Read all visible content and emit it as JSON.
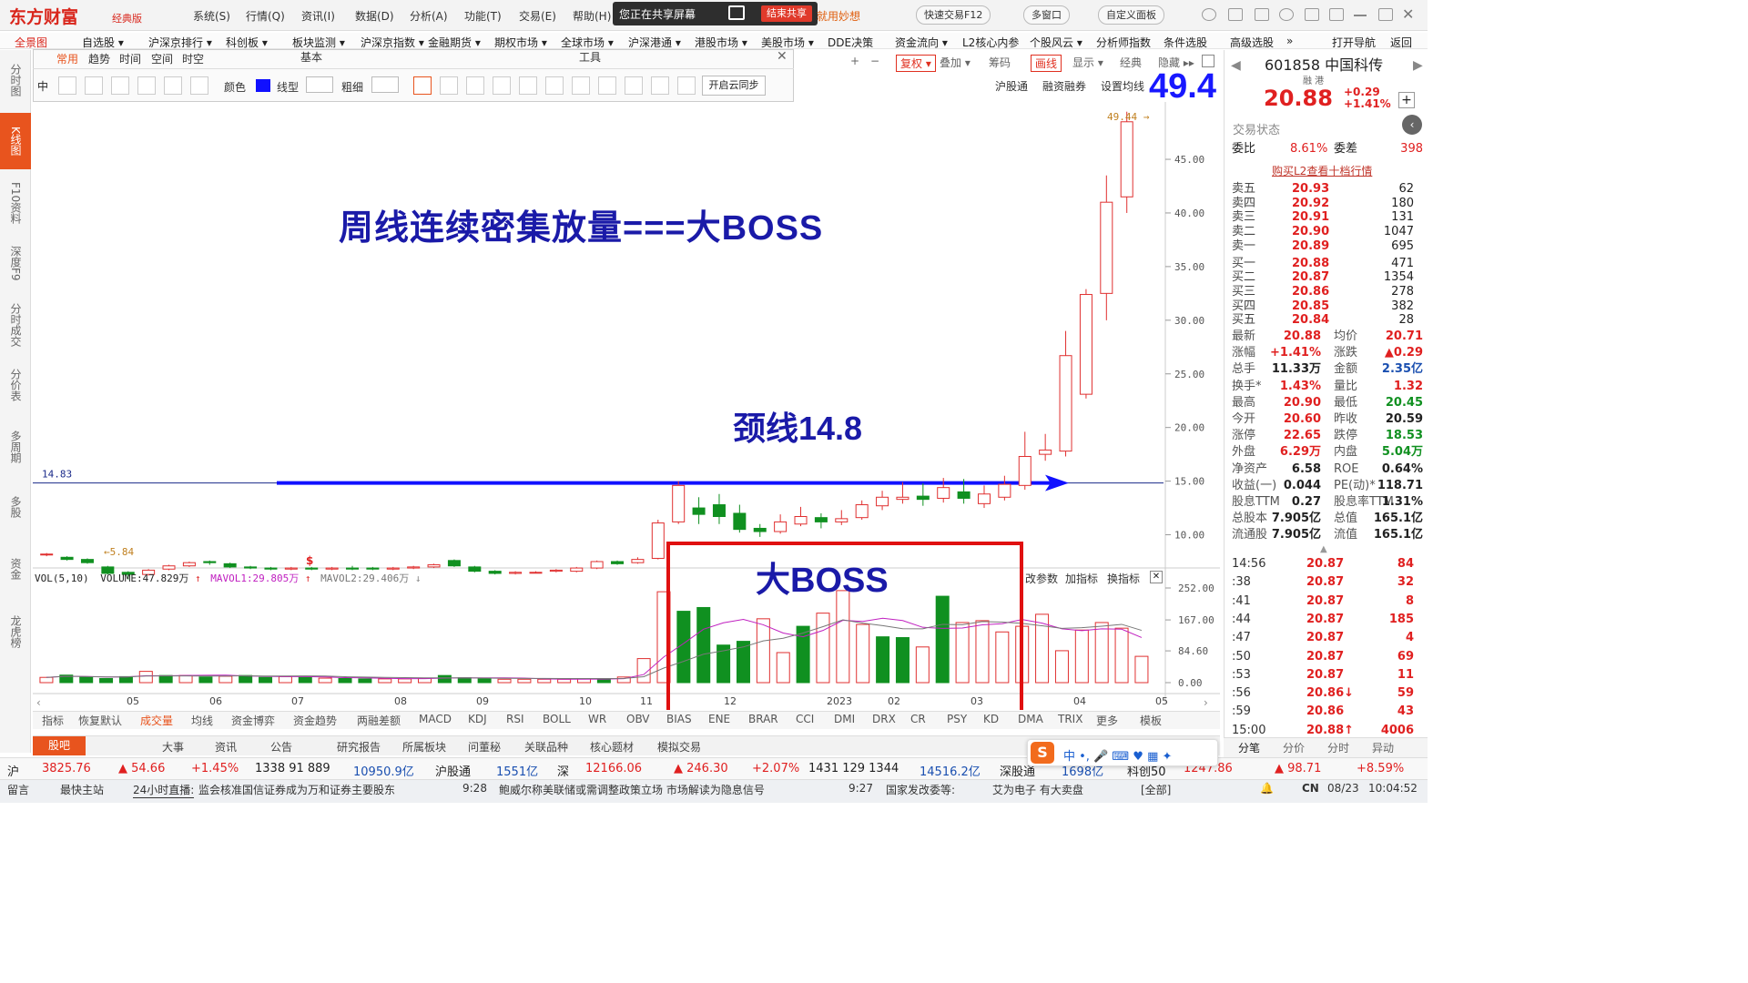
{
  "app": {
    "logo": "东方财富",
    "edition": "经典版"
  },
  "top_menu": [
    "系统(S)",
    "行情(Q)",
    "资讯(I)",
    "数据(D)",
    "分析(A)",
    "功能(T)",
    "交易(E)",
    "帮助(H)"
  ],
  "share": {
    "status": "您正在共享屏幕",
    "end_button": "结束共享",
    "slogan": "就用妙想"
  },
  "top_buttons": [
    "快速交易F12",
    "多窗口",
    "自定义面板"
  ],
  "nav": [
    "全景图",
    "自选股 ▾",
    "沪深京排行 ▾",
    "科创板 ▾",
    "板块监测 ▾",
    "沪深京指数 ▾",
    "金融期货 ▾",
    "期权市场 ▾",
    "全球市场 ▾",
    "沪深港通 ▾",
    "港股市场 ▾",
    "美股市场 ▾",
    "DDE决策",
    "资金流向 ▾",
    "L2核心内参",
    "个股风云 ▾",
    "分析师指数",
    "条件选股",
    "高级选股",
    "»",
    "打开导航",
    "返回"
  ],
  "left_tabs": [
    "分时图",
    "K线图",
    "F10资料",
    "深度F9",
    "分时成交",
    "分价表",
    "多周期",
    "多股",
    "资金",
    "龙虎榜"
  ],
  "toolpanel": {
    "tabs": [
      "常用",
      "趋势",
      "时间",
      "空间",
      "时空"
    ],
    "section_basic": "基本",
    "section_tools": "工具",
    "color_label": "颜色",
    "line_type_label": "线型",
    "thickness_label": "粗细",
    "cloud_sync": "开启云同步",
    "side_label": "中"
  },
  "kline_toolbar": [
    "+",
    "−",
    "复权 ▾",
    "叠加 ▾",
    "筹码",
    "画线",
    "显示 ▾",
    "经典",
    "隐藏 ▸▸"
  ],
  "kline_sub": [
    "沪股通",
    "融资融券",
    "设置均线"
  ],
  "annotations": {
    "title": "周线连续密集放量===大BOSS",
    "neckline": "颈线14.8",
    "boss_box": "大BOSS",
    "big_price": "49.4"
  },
  "chart_data": {
    "type": "candlestick",
    "period": "weekly",
    "price_axis": {
      "ticks": [
        10.0,
        15.0,
        20.0,
        25.0,
        30.0,
        35.0,
        40.0,
        45.0
      ],
      "min": 7.5,
      "max": 49.5
    },
    "neckline": 14.83,
    "high_label": "49.44",
    "low_label": "5.84",
    "x_labels": [
      "05",
      "06",
      "07",
      "08",
      "09",
      "10",
      "11",
      "12",
      "2023",
      "02",
      "03",
      "04",
      "05"
    ],
    "candles": [
      [
        8.2,
        8.2,
        8.0,
        8.3
      ],
      [
        7.9,
        7.7,
        7.6,
        8.0
      ],
      [
        7.7,
        7.4,
        7.3,
        7.8
      ],
      [
        7.0,
        6.4,
        6.3,
        7.1
      ],
      [
        6.5,
        6.3,
        5.84,
        6.6
      ],
      [
        6.3,
        6.7,
        6.2,
        6.8
      ],
      [
        6.8,
        7.1,
        6.7,
        7.2
      ],
      [
        7.1,
        7.4,
        7.0,
        7.5
      ],
      [
        7.5,
        7.4,
        7.2,
        7.6
      ],
      [
        7.3,
        7.0,
        6.9,
        7.4
      ],
      [
        7.0,
        6.9,
        6.8,
        7.1
      ],
      [
        6.9,
        6.8,
        6.7,
        7.0
      ],
      [
        6.8,
        6.9,
        6.7,
        7.0
      ],
      [
        6.9,
        6.8,
        6.7,
        7.0
      ],
      [
        6.8,
        6.9,
        6.7,
        7.0
      ],
      [
        6.9,
        6.8,
        6.7,
        7.1
      ],
      [
        6.9,
        6.8,
        6.7,
        7.0
      ],
      [
        6.8,
        6.9,
        6.7,
        7.0
      ],
      [
        6.9,
        7.0,
        6.8,
        7.1
      ],
      [
        7.0,
        7.2,
        6.9,
        7.3
      ],
      [
        7.6,
        7.1,
        7.0,
        7.7
      ],
      [
        7.0,
        6.6,
        6.5,
        7.1
      ],
      [
        6.6,
        6.4,
        6.3,
        6.7
      ],
      [
        6.4,
        6.5,
        6.3,
        6.6
      ],
      [
        6.5,
        6.5,
        6.4,
        6.6
      ],
      [
        6.6,
        6.7,
        6.5,
        6.8
      ],
      [
        6.6,
        6.9,
        6.5,
        7.0
      ],
      [
        6.9,
        7.5,
        6.8,
        7.6
      ],
      [
        7.5,
        7.3,
        7.2,
        7.6
      ],
      [
        7.4,
        7.7,
        7.3,
        7.9
      ],
      [
        7.8,
        11.1,
        7.7,
        11.4
      ],
      [
        11.2,
        14.6,
        11.0,
        15.0
      ],
      [
        12.5,
        11.9,
        11.0,
        13.5
      ],
      [
        12.8,
        11.7,
        11.0,
        13.8
      ],
      [
        12.0,
        10.5,
        10.2,
        12.8
      ],
      [
        10.6,
        10.3,
        9.8,
        11.0
      ],
      [
        10.3,
        11.2,
        10.1,
        11.9
      ],
      [
        11.0,
        11.7,
        10.8,
        12.6
      ],
      [
        11.6,
        11.2,
        10.6,
        12.0
      ],
      [
        11.2,
        11.5,
        10.9,
        12.3
      ],
      [
        11.6,
        12.8,
        11.4,
        13.2
      ],
      [
        12.7,
        13.5,
        12.3,
        14.1
      ],
      [
        13.3,
        13.5,
        12.9,
        14.9
      ],
      [
        13.6,
        13.3,
        12.7,
        14.8
      ],
      [
        13.4,
        14.4,
        13.0,
        15.3
      ],
      [
        14.0,
        13.4,
        12.9,
        15.2
      ],
      [
        12.9,
        13.8,
        12.5,
        14.6
      ],
      [
        13.5,
        14.7,
        13.2,
        15.5
      ],
      [
        14.6,
        17.3,
        14.2,
        19.6
      ],
      [
        17.5,
        17.9,
        16.9,
        19.4
      ],
      [
        17.8,
        26.7,
        17.3,
        29.0
      ],
      [
        23.1,
        32.4,
        22.7,
        32.9
      ],
      [
        32.5,
        41.0,
        30.0,
        43.5
      ],
      [
        41.5,
        48.5,
        40.0,
        49.44
      ]
    ],
    "volume": {
      "axis_ticks": [
        0.0,
        84.6,
        167.0,
        252.0
      ],
      "vol": "47.829万",
      "mavol1": "29.805万",
      "mavol2": "29.406万",
      "bars": [
        14,
        20,
        15,
        11,
        16,
        30,
        19,
        19,
        15,
        17,
        19,
        14,
        16,
        14,
        12,
        11,
        10,
        10,
        10,
        12,
        19,
        13,
        10,
        9,
        9,
        9,
        9,
        10,
        10,
        15,
        64,
        242,
        190,
        200,
        100,
        110,
        170,
        80,
        150,
        185,
        245,
        155,
        122,
        120,
        95,
        230,
        160,
        165,
        135,
        150,
        182,
        85,
        140,
        160,
        145,
        70
      ],
      "up_flags": [
        1,
        0,
        0,
        0,
        0,
        1,
        0,
        1,
        0,
        1,
        0,
        0,
        1,
        0,
        1,
        0,
        0,
        1,
        1,
        1,
        0,
        0,
        0,
        1,
        1,
        1,
        1,
        1,
        0,
        1,
        1,
        1,
        0,
        0,
        0,
        0,
        1,
        1,
        0,
        1,
        1,
        1,
        0,
        0,
        1,
        0,
        1,
        1,
        1,
        1,
        1,
        1,
        1,
        1,
        1,
        1
      ]
    }
  },
  "vol_header": {
    "name": "VOL(5,10)",
    "vol_label": "VOLUME:47.829万",
    "mavol1_label": "MAVOL1:29.805万",
    "mavol2_label": "MAVOL2:29.406万"
  },
  "vol_side": [
    "改参数",
    "加指标",
    "换指标"
  ],
  "indicators": [
    "指标",
    "恢复默认",
    "成交量",
    "均线",
    "资金博弈",
    "资金趋势",
    "两融差额",
    "MACD",
    "KDJ",
    "RSI",
    "BOLL",
    "WR",
    "OBV",
    "BIAS",
    "ENE",
    "BRAR",
    "CCI",
    "DMI",
    "DRX",
    "CR",
    "PSY",
    "KD",
    "DMA",
    "TRIX",
    "更多",
    "模板"
  ],
  "bottom_tabs": [
    "股吧",
    "大事",
    "资讯",
    "公告",
    "研究报告",
    "所属板块",
    "问董秘",
    "关联品种",
    "核心题材",
    "模拟交易"
  ],
  "quote_panel": {
    "code_name": "601858 中国科传",
    "tags": "融  港",
    "price": "20.88",
    "change": "+0.29",
    "change_pct": "+1.41%",
    "state": "交易状态",
    "weibi_label": "委比",
    "weibi": "8.61%",
    "weicha_label": "委差",
    "weicha": "398",
    "l2_link": "购买L2查看十档行情",
    "asks": [
      [
        "卖五",
        "20.93",
        "62"
      ],
      [
        "卖四",
        "20.92",
        "180"
      ],
      [
        "卖三",
        "20.91",
        "131"
      ],
      [
        "卖二",
        "20.90",
        "1047"
      ],
      [
        "卖一",
        "20.89",
        "695"
      ]
    ],
    "bids": [
      [
        "买一",
        "20.88",
        "471"
      ],
      [
        "买二",
        "20.87",
        "1354"
      ],
      [
        "买三",
        "20.86",
        "278"
      ],
      [
        "买四",
        "20.85",
        "382"
      ],
      [
        "买五",
        "20.84",
        "28"
      ]
    ],
    "stats": [
      [
        "最新",
        "20.88",
        "均价",
        "20.71"
      ],
      [
        "涨幅",
        "+1.41%",
        "涨跌",
        "▲0.29"
      ],
      [
        "总手",
        "11.33万",
        "金额",
        "2.35亿"
      ],
      [
        "换手*",
        "1.43%",
        "量比",
        "1.32"
      ],
      [
        "最高",
        "20.90",
        "最低",
        "20.45"
      ],
      [
        "今开",
        "20.60",
        "昨收",
        "20.59"
      ],
      [
        "涨停",
        "22.65",
        "跌停",
        "18.53"
      ],
      [
        "外盘",
        "6.29万",
        "内盘",
        "5.04万"
      ],
      [
        "净资产",
        "6.58",
        "ROE",
        "0.64%"
      ],
      [
        "收益(一)",
        "0.044",
        "PE(动)*",
        "118.71"
      ],
      [
        "股息TTM",
        "0.27",
        "股息率TTM",
        "1.31%"
      ],
      [
        "总股本",
        "7.905亿",
        "总值",
        "165.1亿"
      ],
      [
        "流通股",
        "7.905亿",
        "流值",
        "165.1亿"
      ]
    ],
    "ticks": [
      [
        "14:56",
        "20.87",
        "84"
      ],
      [
        ":38",
        "20.87",
        "32"
      ],
      [
        ":41",
        "20.87",
        "8"
      ],
      [
        ":44",
        "20.87",
        "185"
      ],
      [
        ":47",
        "20.87",
        "4"
      ],
      [
        ":50",
        "20.87",
        "69"
      ],
      [
        ":53",
        "20.87",
        "11"
      ],
      [
        ":56",
        "20.86↓",
        "59"
      ],
      [
        ":59",
        "20.86",
        "43"
      ],
      [
        "15:00",
        "20.88↑",
        "4006"
      ]
    ],
    "tabs": [
      "分笔",
      "分价",
      "分时",
      "异动"
    ]
  },
  "status_bar": {
    "sh": "沪",
    "sh_idx": "3825.76",
    "sh_chg": "▲ 54.66",
    "sh_pct": "+1.45%",
    "sh_cnt": "1338  91  889",
    "sh_amt": "10950.9亿",
    "hgt_label": "沪股通",
    "hgt": "1551亿",
    "sz": "深",
    "sz_idx": "12166.06",
    "sz_chg": "▲ 246.30",
    "sz_pct": "+2.07%",
    "sz_cnt": "1431  129  1344",
    "sz_amt": "14516.2亿",
    "sgt_label": "深股通",
    "sgt": "1698亿",
    "kc": "科创50",
    "kc_idx": "1247.86",
    "kc_chg": "▲ 98.71",
    "kc_pct": "+8.59%"
  },
  "news_bar": {
    "msg": "留言",
    "site": "最快主站",
    "live": "24小时直播:",
    "news1": "监会核准国信证券成为万和证券主要股东",
    "t2": "9:28",
    "news2": "鲍威尔称美联储或需调整政策立场 市场解读为隐息信号",
    "t3": "9:27",
    "news3": "国家发改委等:",
    "news4": "艾为电子 有大卖盘",
    "all": "[全部]",
    "region": "CN",
    "date": "08/23",
    "time": "10:04:52"
  }
}
